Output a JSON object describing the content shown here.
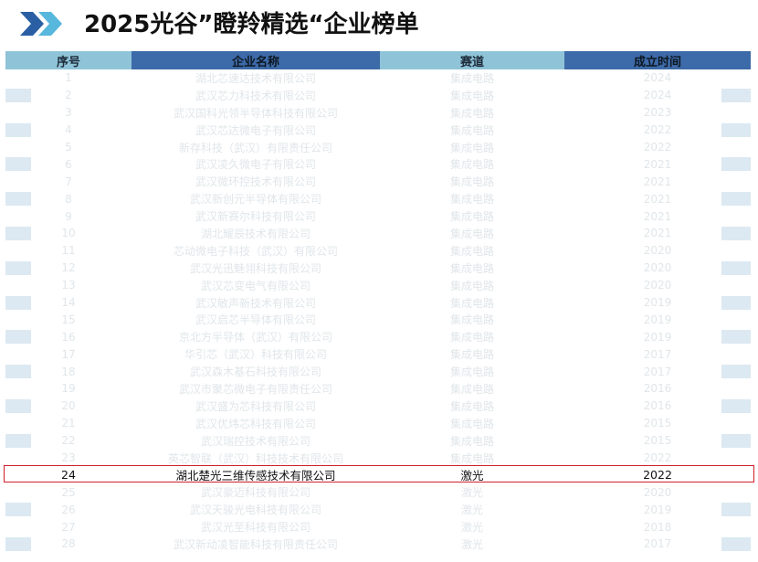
{
  "header": {
    "title": "2025光谷”瞪羚精选“企业榜单",
    "icon": "double-chevron-icon",
    "accent_colors": [
      "#2b5fa4",
      "#57b7dd"
    ]
  },
  "table": {
    "columns": [
      "序号",
      "企业名称",
      "赛道",
      "成立时间"
    ],
    "rows": [
      {
        "no": "1",
        "name": "湖北芯速达技术有限公司",
        "track": "集成电路",
        "year": "2024"
      },
      {
        "no": "2",
        "name": "武汉芯力科技术有限公司",
        "track": "集成电路",
        "year": "2024"
      },
      {
        "no": "3",
        "name": "武汉国科光领半导体科技有限公司",
        "track": "集成电路",
        "year": "2023"
      },
      {
        "no": "4",
        "name": "武汉芯达微电子有限公司",
        "track": "集成电路",
        "year": "2022"
      },
      {
        "no": "5",
        "name": "新存科技（武汉）有限责任公司",
        "track": "集成电路",
        "year": "2022"
      },
      {
        "no": "6",
        "name": "武汉凌久微电子有限公司",
        "track": "集成电路",
        "year": "2021"
      },
      {
        "no": "7",
        "name": "武汉微环控技术有限公司",
        "track": "集成电路",
        "year": "2021"
      },
      {
        "no": "8",
        "name": "武汉新创元半导体有限公司",
        "track": "集成电路",
        "year": "2021"
      },
      {
        "no": "9",
        "name": "武汉新赛尔科技有限公司",
        "track": "集成电路",
        "year": "2021"
      },
      {
        "no": "10",
        "name": "湖北耀辰技术有限公司",
        "track": "集成电路",
        "year": "2021"
      },
      {
        "no": "11",
        "name": "芯动微电子科技（武汉）有限公司",
        "track": "集成电路",
        "year": "2020"
      },
      {
        "no": "12",
        "name": "武汉光迅魅翎科技有限公司",
        "track": "集成电路",
        "year": "2020"
      },
      {
        "no": "13",
        "name": "武汉芯变电气有限公司",
        "track": "集成电路",
        "year": "2020"
      },
      {
        "no": "14",
        "name": "武汉敏声新技术有限公司",
        "track": "集成电路",
        "year": "2019"
      },
      {
        "no": "15",
        "name": "武汉启芯半导体有限公司",
        "track": "集成电路",
        "year": "2019"
      },
      {
        "no": "16",
        "name": "京北方半导体（武汉）有限公司",
        "track": "集成电路",
        "year": "2019"
      },
      {
        "no": "17",
        "name": "华引芯（武汉）科技有限公司",
        "track": "集成电路",
        "year": "2017"
      },
      {
        "no": "18",
        "name": "武汉森木基石科技有限公司",
        "track": "集成电路",
        "year": "2017"
      },
      {
        "no": "19",
        "name": "武汉市聚芯微电子有限责任公司",
        "track": "集成电路",
        "year": "2016"
      },
      {
        "no": "20",
        "name": "武汉盛为芯科技有限公司",
        "track": "集成电路",
        "year": "2016"
      },
      {
        "no": "21",
        "name": "武汉优炜芯科技有限公司",
        "track": "集成电路",
        "year": "2015"
      },
      {
        "no": "22",
        "name": "武汉瑞控技术有限公司",
        "track": "集成电路",
        "year": "2015"
      },
      {
        "no": "23",
        "name": "英芯智联（武汉）科技技术有限公司",
        "track": "集成电路",
        "year": "2022"
      },
      {
        "no": "24",
        "name": "湖北楚光三维传感技术有限公司",
        "track": "激光",
        "year": "2022",
        "highlight": true
      },
      {
        "no": "25",
        "name": "武汉豪迈科技有限公司",
        "track": "激光",
        "year": "2020"
      },
      {
        "no": "26",
        "name": "武汉天骏光电科技有限公司",
        "track": "激光",
        "year": "2019"
      },
      {
        "no": "27",
        "name": "武汉光至科技有限公司",
        "track": "激光",
        "year": "2018"
      },
      {
        "no": "28",
        "name": "武汉新动凌智能科技有限责任公司",
        "track": "激光",
        "year": "2017"
      }
    ]
  },
  "colors": {
    "header_light": "#8fc4d8",
    "header_dark": "#3d6aa8",
    "highlight_border": "#d0202a",
    "faded_text": "#e0e6ea"
  }
}
